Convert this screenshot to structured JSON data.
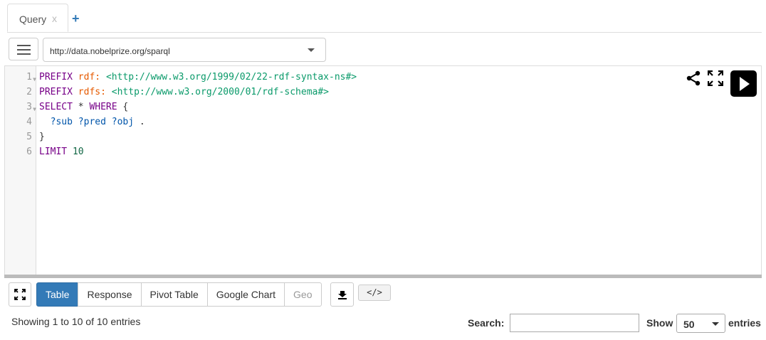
{
  "tabs": [
    {
      "label": "Query",
      "close": "x"
    }
  ],
  "add_tab": "+",
  "endpoint": {
    "value": "http://data.nobelprize.org/sparql"
  },
  "editor": {
    "line_numbers": [
      "1",
      "2",
      "3",
      "4",
      "5",
      "6"
    ],
    "lines": [
      [
        {
          "t": "PREFIX",
          "c": "kw"
        },
        {
          "t": " ",
          "c": ""
        },
        {
          "t": "rdf:",
          "c": "pfx"
        },
        {
          "t": " ",
          "c": ""
        },
        {
          "t": "<http://www.w3.org/1999/02/22-rdf-syntax-ns#>",
          "c": "iri"
        }
      ],
      [
        {
          "t": "PREFIX",
          "c": "kw"
        },
        {
          "t": " ",
          "c": ""
        },
        {
          "t": "rdfs:",
          "c": "pfx"
        },
        {
          "t": " ",
          "c": ""
        },
        {
          "t": "<http://www.w3.org/2000/01/rdf-schema#>",
          "c": "iri"
        }
      ],
      [
        {
          "t": "SELECT",
          "c": "kw"
        },
        {
          "t": " * ",
          "c": ""
        },
        {
          "t": "WHERE",
          "c": "kw"
        },
        {
          "t": " {",
          "c": ""
        }
      ],
      [
        {
          "t": "  ",
          "c": ""
        },
        {
          "t": "?sub",
          "c": "var"
        },
        {
          "t": " ",
          "c": ""
        },
        {
          "t": "?pred",
          "c": "var"
        },
        {
          "t": " ",
          "c": ""
        },
        {
          "t": "?obj",
          "c": "var"
        },
        {
          "t": " .",
          "c": ""
        }
      ],
      [
        {
          "t": "}",
          "c": ""
        }
      ],
      [
        {
          "t": "LIMIT",
          "c": "kw"
        },
        {
          "t": " ",
          "c": ""
        },
        {
          "t": "10",
          "c": "num"
        }
      ]
    ]
  },
  "results": {
    "tabs": [
      "Table",
      "Response",
      "Pivot Table",
      "Google Chart",
      "Geo"
    ],
    "active_tab": "Table",
    "disabled_tab": "Geo",
    "embed_label": "</>",
    "info": "Showing 1 to 10 of 10 entries",
    "search_label": "Search:",
    "search_value": "",
    "show_label": "Show",
    "page_size": "50",
    "entries_label": "entries"
  },
  "icons": {
    "menu": "menu-icon",
    "share": "share-icon",
    "fullscreen": "fullscreen-icon",
    "run": "play-icon",
    "download": "download-icon"
  },
  "colors": {
    "active_tab": "#337ab7",
    "run_button": "#000000"
  }
}
